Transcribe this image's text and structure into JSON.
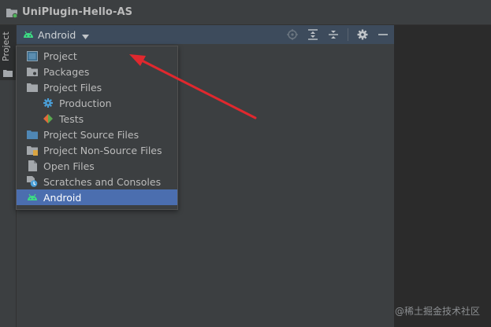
{
  "titlebar": {
    "title": "UniPlugin-Hello-AS",
    "icon": "project-folder-icon"
  },
  "sidebar": {
    "tab_label": "Project"
  },
  "panel": {
    "view_selector": {
      "label": "Android",
      "icon": "android-icon"
    },
    "toolbar": [
      {
        "name": "locate-icon"
      },
      {
        "name": "expand-all-icon"
      },
      {
        "name": "collapse-all-icon"
      },
      {
        "name": "settings-gear-icon"
      },
      {
        "name": "minimize-icon"
      }
    ]
  },
  "dropdown": {
    "items": [
      {
        "label": "Project",
        "icon": "project-view-icon",
        "indent": false,
        "selected": false
      },
      {
        "label": "Packages",
        "icon": "packages-folder-icon",
        "indent": false,
        "selected": false
      },
      {
        "label": "Project Files",
        "icon": "folder-icon",
        "indent": false,
        "selected": false
      },
      {
        "label": "Production",
        "icon": "production-gear-icon",
        "indent": true,
        "selected": false
      },
      {
        "label": "Tests",
        "icon": "tests-icon",
        "indent": true,
        "selected": false
      },
      {
        "label": "Project Source Files",
        "icon": "source-folder-icon",
        "indent": false,
        "selected": false
      },
      {
        "label": "Project Non-Source Files",
        "icon": "non-source-folder-icon",
        "indent": false,
        "selected": false
      },
      {
        "label": "Open Files",
        "icon": "file-icon",
        "indent": false,
        "selected": false
      },
      {
        "label": "Scratches and Consoles",
        "icon": "scratches-icon",
        "indent": false,
        "selected": false
      },
      {
        "label": "Android",
        "icon": "android-icon",
        "indent": false,
        "selected": true
      }
    ]
  },
  "watermark": "@稀土掘金技术社区",
  "colors": {
    "accent_selected": "#4b6eaf",
    "annotation_arrow": "#e0282e",
    "android_green": "#3ddc84"
  }
}
